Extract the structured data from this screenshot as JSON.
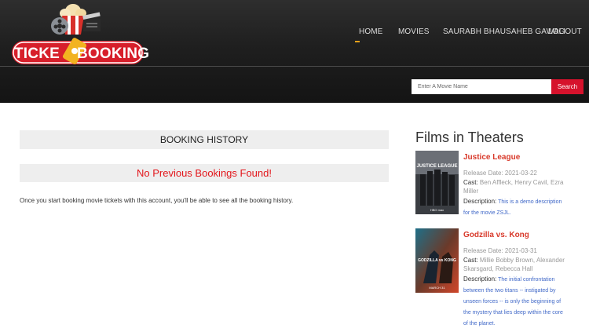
{
  "brand": {
    "logo_left": "TICKE",
    "logo_right": "BOOKING"
  },
  "nav": {
    "items": [
      {
        "label": "HOME",
        "active": true
      },
      {
        "label": "MOVIES",
        "active": false
      },
      {
        "label": "SAURABH BHAUSAHEB GAWALI",
        "active": false
      },
      {
        "label": "LOGOUT",
        "active": false
      }
    ],
    "accent_color": "#e8a11a"
  },
  "search": {
    "placeholder": "Enter A Movie Name",
    "button_label": "Search",
    "button_color": "#d6122c"
  },
  "main": {
    "title": "BOOKING HISTORY",
    "empty_message": "No Previous Bookings Found!",
    "info": "Once you start booking movie tickets with this account, you'll be able to see all the booking history."
  },
  "sidebar": {
    "title": "Films in Theaters",
    "movies": [
      {
        "title": "Justice League",
        "release_label": "Release Date: 2021-03-22",
        "cast_label": "Cast:",
        "cast": "Ben Affleck, Henry Cavil, Ezra Miller",
        "description_label": "Description:",
        "description": "This is a demo description for the movie ZSJL.",
        "poster_text": "JUSTICE LEAGUE",
        "poster_sub": "HBO max"
      },
      {
        "title": "Godzilla vs. Kong",
        "release_label": "Release Date: 2021-03-31",
        "cast_label": "Cast:",
        "cast": "Millie Bobby Brown, Alexander Skarsgard, Rebecca Hall",
        "description_label": "Description:",
        "description": "The initial confrontation between the two titans -- instigated by unseen forces -- is only the beginning of the mystery that lies deep within the core of the planet.",
        "poster_text": "GODZILLA vs KONG",
        "poster_sub": "MARCH 31"
      }
    ]
  }
}
